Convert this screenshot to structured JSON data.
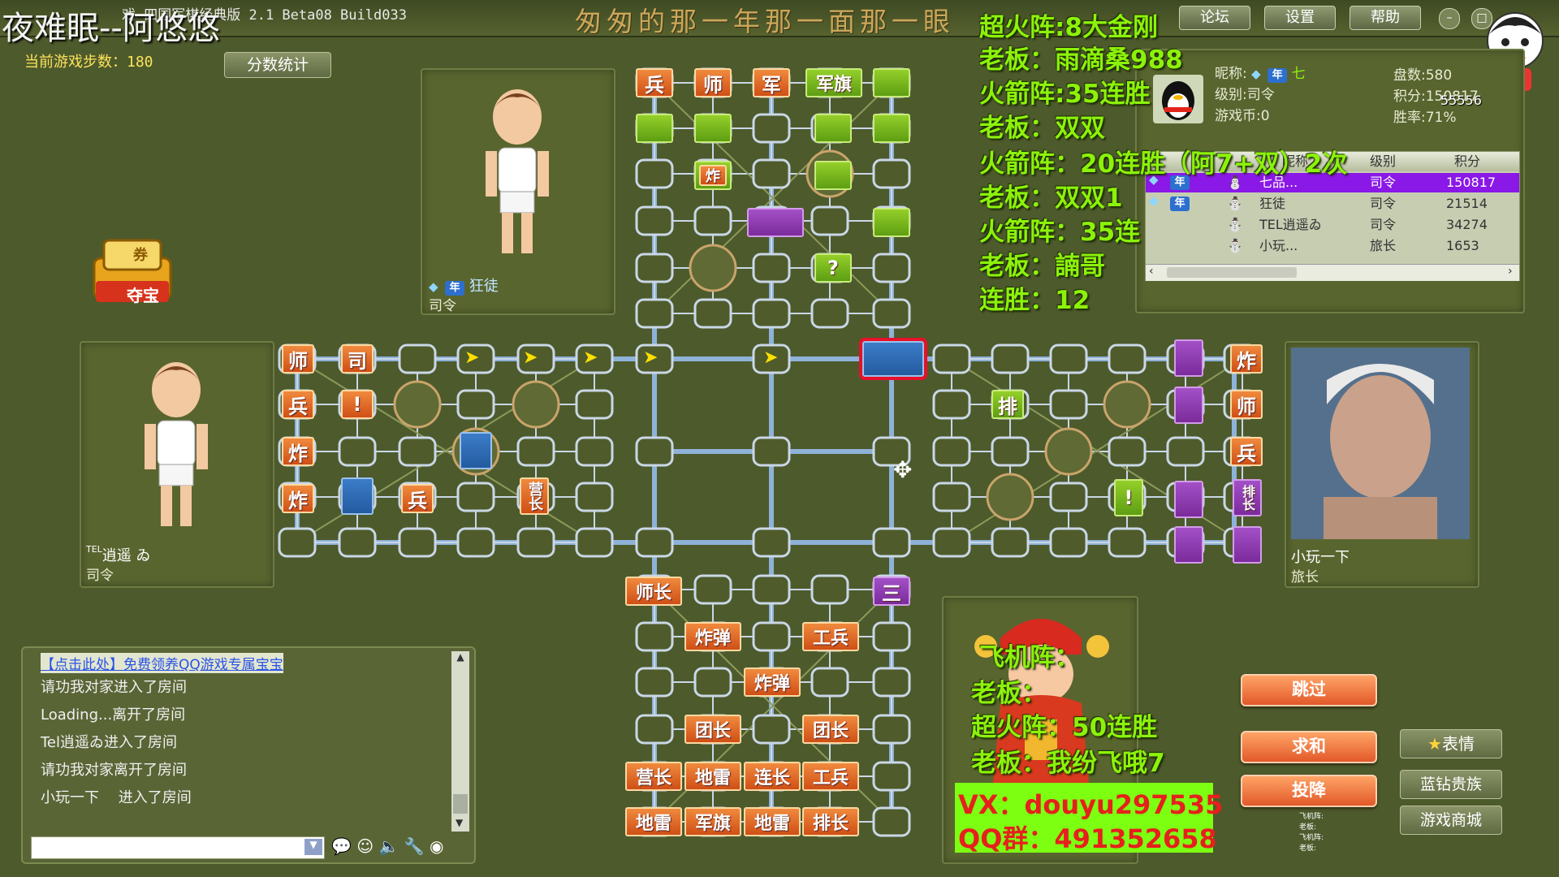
{
  "colors": {
    "accent_green": "#8cf20a",
    "board_orange": "#e66a28",
    "piece_green": "#7ab81e",
    "piece_purple": "#8e3bb2",
    "piece_blue": "#2f6db8",
    "highlight_red": "#e8102a"
  },
  "window": {
    "title_fragment": "戏-四国军棋经典版 2.1 Beta08 Build033",
    "streamer_overlay": "夜难眠--阿悠悠",
    "marquee": "匆匆的那一年那一面那一眼",
    "menu": {
      "forum": "论坛",
      "settings": "设置",
      "help": "帮助"
    },
    "min_glyph": "–",
    "close_glyph": "□"
  },
  "left": {
    "steps_label": "当前游戏步数：",
    "steps_value": "180",
    "score_stats_button": "分数统计",
    "treasure_label": "夺宝",
    "treasure_ticket": "券"
  },
  "players": {
    "top": {
      "name": "狂徒",
      "rank": "司令",
      "vip_tag": "年"
    },
    "left": {
      "name": "逍遥 ゐ",
      "name_prefix": "TEL",
      "rank": "司令"
    },
    "right": {
      "name": "小玩一下",
      "rank": "旅长"
    }
  },
  "profile": {
    "nickname_label": "昵称:",
    "nickname_value": "七",
    "vip_tag": "年",
    "level_label": "级别:",
    "level_value": "司令",
    "coins_label": "游戏币:",
    "coins_value": "0",
    "games_label": "盘数:",
    "games_value": "580",
    "points_label": "积分:",
    "points_value": "150817",
    "winrate_label": "胜率:",
    "winrate_value": "71%",
    "extra_number": "55556"
  },
  "player_table": {
    "headers": [
      "昵称",
      "级别",
      "积分"
    ],
    "rows": [
      {
        "name": "七品...",
        "rank": "司令",
        "score": "150817",
        "selected": true,
        "vip": "年"
      },
      {
        "name": "狂徒",
        "rank": "司令",
        "score": "21514",
        "selected": false,
        "vip": "年"
      },
      {
        "name": "TEL逍遥ゐ",
        "rank": "司令",
        "score": "34274",
        "selected": false,
        "vip": ""
      },
      {
        "name": "小玩...",
        "rank": "旅长",
        "score": "1653",
        "selected": false,
        "vip": ""
      }
    ]
  },
  "overlay_right": [
    "超火阵:8大金刚",
    "老板：雨滴桑988",
    "火箭阵:35连胜",
    "老板：双双",
    "火箭阵：20连胜（阿7+双）2次",
    "老板：双双1",
    "火箭阵：35连",
    "老板：諵哥",
    "连胜：12"
  ],
  "overlay_center": [
    "飞机阵：",
    "老板：",
    "超火阵：50连胜",
    "老板：我纷飞哦7"
  ],
  "contact": {
    "vx": "VX：douyu297535",
    "qq": "QQ群：491352658"
  },
  "chat": {
    "link": "【点击此处】免费领养QQ游戏专属宝宝",
    "lines": [
      "请功我对家进入了房间",
      "Loading...离开了房间",
      "Tel逍遥ゐ进入了房间",
      "请功我对家离开了房间",
      "小玩一下　 进入了房间"
    ],
    "input_placeholder": ""
  },
  "actions": {
    "skip": "跳过",
    "draw": "求和",
    "surrender": "投降",
    "emote": "表情",
    "blue_diamond": "蓝钻贵族",
    "store": "游戏商城",
    "small_notes": [
      "飞机阵:",
      "老板:",
      "飞机阵:",
      "老板:"
    ]
  },
  "board": {
    "top": {
      "row0": [
        "兵",
        "师",
        "军",
        "军旗"
      ],
      "bomb": "炸",
      "question": "?"
    },
    "left": {
      "col0": [
        "师",
        "兵",
        "炸",
        "炸"
      ],
      "siling": "司",
      "alert": "!",
      "soldier": "兵",
      "camp": "营长"
    },
    "right": {
      "col": [
        "炸",
        "师",
        "兵",
        "排长"
      ],
      "pai": "排",
      "alert": "!"
    },
    "bottom": {
      "rows": [
        [
          "师长"
        ],
        [
          "炸弹",
          "工兵"
        ],
        [
          "炸弹"
        ],
        [
          "团长",
          "团长"
        ],
        [
          "营长",
          "地雷",
          "连长",
          "工兵"
        ],
        [
          "地雷",
          "军旗",
          "地雷",
          "排长"
        ]
      ],
      "purple_mark": "三"
    }
  }
}
